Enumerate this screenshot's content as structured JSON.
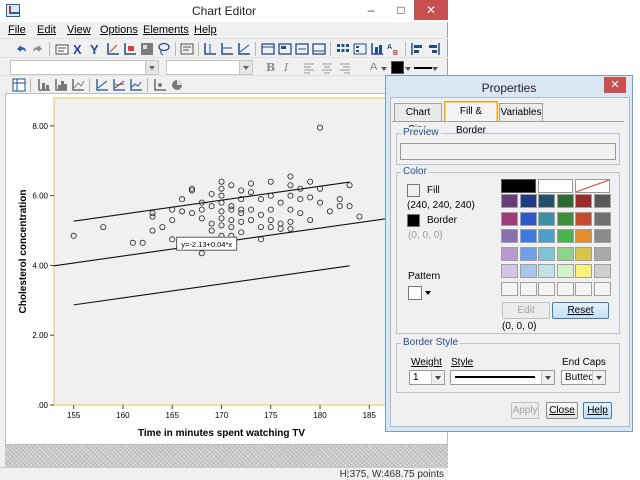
{
  "chart_editor": {
    "title": "Chart Editor",
    "menu": [
      "File",
      "Edit",
      "View",
      "Options",
      "Elements",
      "Help"
    ],
    "menu_underline_index": [
      0,
      0,
      0,
      0,
      0,
      0
    ],
    "format_bar": {
      "bold": "B",
      "italic": "I",
      "text_size": "A"
    },
    "status": "H:375, W:468.75 points"
  },
  "chart_data": {
    "type": "scatter",
    "xlabel": "Time in minutes spent watching TV",
    "ylabel": "Cholesterol concentration",
    "xlim": [
      153,
      187
    ],
    "ylim": [
      0,
      8.8
    ],
    "xticks": [
      155,
      160,
      165,
      170,
      175,
      180,
      185
    ],
    "yticks": [
      0,
      2,
      4,
      6,
      8
    ],
    "ytick_labels": [
      ".00",
      "2.00",
      "4.00",
      "6.00",
      "8.00"
    ],
    "annotation": "y=-2.13+0.04*x",
    "fit_line": {
      "intercept": -2.13,
      "slope": 0.04
    },
    "band_offset": 1.2,
    "points": [
      [
        155,
        4.85
      ],
      [
        158,
        5.1
      ],
      [
        161,
        4.65
      ],
      [
        162,
        4.65
      ],
      [
        163,
        5.0
      ],
      [
        163,
        5.4
      ],
      [
        163,
        5.5
      ],
      [
        164,
        5.1
      ],
      [
        165,
        5.3
      ],
      [
        165,
        4.75
      ],
      [
        165,
        5.6
      ],
      [
        166,
        5.55
      ],
      [
        166,
        5.9
      ],
      [
        167,
        6.2
      ],
      [
        167,
        6.15
      ],
      [
        167,
        5.5
      ],
      [
        167,
        4.65
      ],
      [
        168,
        5.8
      ],
      [
        168,
        5.6
      ],
      [
        168,
        5.35
      ],
      [
        168,
        4.35
      ],
      [
        169,
        5.7
      ],
      [
        169,
        5.2
      ],
      [
        169,
        5.0
      ],
      [
        169,
        6.05
      ],
      [
        169,
        4.6
      ],
      [
        170,
        6.4
      ],
      [
        170,
        6.2
      ],
      [
        170,
        6.0
      ],
      [
        170,
        5.8
      ],
      [
        170,
        5.55
      ],
      [
        170,
        5.35
      ],
      [
        170,
        5.15
      ],
      [
        170,
        4.85
      ],
      [
        171,
        5.7
      ],
      [
        171,
        5.6
      ],
      [
        171,
        5.3
      ],
      [
        171,
        5.1
      ],
      [
        171,
        4.85
      ],
      [
        171,
        6.3
      ],
      [
        172,
        6.15
      ],
      [
        172,
        5.9
      ],
      [
        172,
        5.6
      ],
      [
        172,
        5.5
      ],
      [
        172,
        5.25
      ],
      [
        172,
        4.95
      ],
      [
        173,
        6.35
      ],
      [
        173,
        6.1
      ],
      [
        173,
        5.6
      ],
      [
        173,
        5.3
      ],
      [
        174,
        5.9
      ],
      [
        174,
        5.45
      ],
      [
        174,
        5.1
      ],
      [
        174,
        4.75
      ],
      [
        175,
        6.4
      ],
      [
        175,
        6.0
      ],
      [
        175,
        5.6
      ],
      [
        175,
        5.3
      ],
      [
        175,
        5.1
      ],
      [
        176,
        5.8
      ],
      [
        176,
        5.2
      ],
      [
        176,
        5.05
      ],
      [
        177,
        6.55
      ],
      [
        177,
        6.3
      ],
      [
        177,
        6.0
      ],
      [
        177,
        5.6
      ],
      [
        177,
        5.25
      ],
      [
        177,
        5.05
      ],
      [
        178,
        6.2
      ],
      [
        178,
        5.9
      ],
      [
        178,
        5.5
      ],
      [
        179,
        5.95
      ],
      [
        179,
        5.3
      ],
      [
        179,
        6.4
      ],
      [
        180,
        7.95
      ],
      [
        180,
        6.2
      ],
      [
        180,
        5.8
      ],
      [
        181,
        5.55
      ],
      [
        182,
        5.7
      ],
      [
        182,
        5.9
      ],
      [
        183,
        5.7
      ],
      [
        183,
        6.3
      ],
      [
        184,
        5.4
      ]
    ]
  },
  "properties": {
    "title": "Properties",
    "tabs": [
      "Chart Size",
      "Fill & Border",
      "Variables"
    ],
    "active_tab": 1,
    "preview_label": "Preview",
    "color_label": "Color",
    "fill_label": "Fill",
    "fill_value": "(240, 240, 240)",
    "fill_color": "#f0f0f0",
    "border_label": "Border",
    "border_value": "(0, 0, 0)",
    "border_color": "#000000",
    "pattern_label": "Pattern",
    "palette_top": [
      "#000000",
      "#ffffff",
      "none"
    ],
    "palette": [
      [
        "#6b3a78",
        "#1f3b82",
        "#20506a",
        "#2e6a34",
        "#9c2a2a",
        "#595959"
      ],
      [
        "#a03a7c",
        "#2e58c6",
        "#3a8fa3",
        "#3d8f3a",
        "#c94a2a",
        "#6f6f6f"
      ],
      [
        "#8a6fb0",
        "#3c7ae0",
        "#4aa0c8",
        "#4bb34b",
        "#e38c2c",
        "#8a8a8a"
      ],
      [
        "#b89ad0",
        "#6f9fe6",
        "#7fc3d4",
        "#8ed38a",
        "#d9c34a",
        "#a9a9a9"
      ],
      [
        "#d6c2e6",
        "#a9c6ef",
        "#bfe3e6",
        "#d3f2c5",
        "#fff07a",
        "#cfcfcf"
      ],
      [
        "#f4f4f4",
        "#f4f4f4",
        "#f4f4f4",
        "#f4f4f4",
        "#f4f4f4",
        "#f4f4f4"
      ]
    ],
    "edit_label": "Edit",
    "reset_label": "Reset",
    "rgb_value": "(0, 0, 0)",
    "border_style_label": "Border Style",
    "weight_label": "Weight",
    "weight_value": "1",
    "style_label": "Style",
    "end_caps_label": "End Caps",
    "end_caps_value": "Butted",
    "apply_label": "Apply",
    "close_label": "Close",
    "help_label": "Help"
  }
}
